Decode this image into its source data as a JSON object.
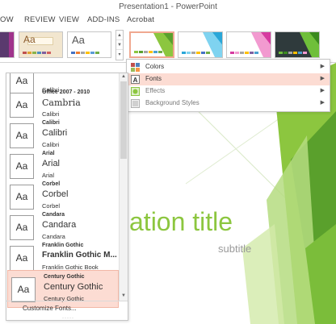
{
  "window": {
    "title": "Presentation1 - PowerPoint"
  },
  "ribbon_tabs": [
    "OW",
    "REVIEW",
    "VIEW",
    "ADD-INS",
    "Acrobat"
  ],
  "themes_gallery": {
    "thumb_text": [
      "Aa",
      "Aa",
      "Aa"
    ]
  },
  "variants_menu": {
    "items": [
      {
        "label": "Colors",
        "icon": "palette-icon",
        "hover": false
      },
      {
        "label": "Fonts",
        "icon": "font-a-icon",
        "hover": true
      },
      {
        "label": "Effects",
        "icon": "effects-icon",
        "hover": false
      },
      {
        "label": "Background Styles",
        "icon": "background-styles-icon",
        "hover": false
      }
    ]
  },
  "fonts_panel": {
    "preview_glyph": "Aa",
    "items": [
      {
        "name": "",
        "major": "",
        "minor": "Calibri",
        "selected": false
      },
      {
        "name": "Office 2007 - 2010",
        "major": "Cambria",
        "minor": "Calibri",
        "selected": false
      },
      {
        "name": "Calibri",
        "major": "Calibri",
        "minor": "Calibri",
        "selected": false
      },
      {
        "name": "Arial",
        "major": "Arial",
        "minor": "Arial",
        "selected": false
      },
      {
        "name": "Corbel",
        "major": "Corbel",
        "minor": "Corbel",
        "selected": false
      },
      {
        "name": "Candara",
        "major": "Candara",
        "minor": "Candara",
        "selected": false
      },
      {
        "name": "Franklin Gothic",
        "major": "Franklin Gothic M...",
        "minor": "Franklin Gothic Book",
        "selected": false
      },
      {
        "name": "Century Gothic",
        "major": "Century Gothic",
        "minor": "Century Gothic",
        "selected": true
      }
    ],
    "customize_label": "Customize Fonts...",
    "grip": "·····"
  },
  "slide": {
    "title": "ation title",
    "subtitle": "subtitle"
  },
  "colors": {
    "accent_green": "#8cc63f",
    "hover_pink": "#fcdcd3",
    "border_pink": "#f2b7a6"
  }
}
